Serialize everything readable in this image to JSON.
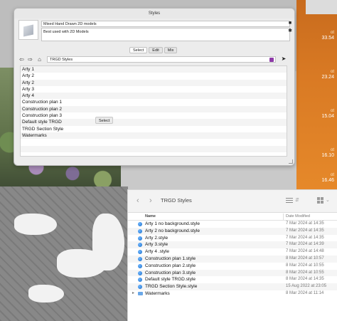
{
  "styles_panel": {
    "title": "Styles",
    "style_name": "Mixed Hand Drawn 2D models",
    "style_description": "Best used with 2D Models",
    "tabs": [
      {
        "label": "Select",
        "active": true
      },
      {
        "label": "Edit",
        "active": false
      },
      {
        "label": "Mix",
        "active": false
      }
    ],
    "collection": "TRGD Styles",
    "styles": [
      "Arty 1",
      "Arty 2",
      "Arty 2",
      "Arty 3",
      "Arty 4",
      "Construction plan 1",
      "Construction plan 2",
      "Construction plan 3",
      "Default style TRGD",
      "TRGD Section Style",
      "Watermarks"
    ],
    "tooltip": "Select"
  },
  "finder": {
    "title": "TRGD Styles",
    "columns": {
      "name": "Name",
      "date": "Date Modified"
    },
    "files": [
      {
        "name": "Arty 1 no background.style",
        "date": "7 Mar 2024 at 14:35",
        "kind": "file"
      },
      {
        "name": "Arty 2 no background.style",
        "date": "7 Mar 2024 at 14:35",
        "kind": "file"
      },
      {
        "name": "Arty 2.style",
        "date": "7 Mar 2024 at 14:35",
        "kind": "file"
      },
      {
        "name": "Arty 3.style",
        "date": "7 Mar 2024 at 14:39",
        "kind": "file"
      },
      {
        "name": "Arty 4 .style",
        "date": "7 Mar 2024 at 14:48",
        "kind": "file"
      },
      {
        "name": "Construction plan 1.style",
        "date": "8 Mar 2024 at 10:57",
        "kind": "file"
      },
      {
        "name": "Construction plan 2.style",
        "date": "8 Mar 2024 at 10:55",
        "kind": "file"
      },
      {
        "name": "Construction plan 3.style",
        "date": "8 Mar 2024 at 10:55",
        "kind": "file"
      },
      {
        "name": "Default style TRGD.style",
        "date": "8 Mar 2024 at 14:35",
        "kind": "file"
      },
      {
        "name": "TRGD Section Style.style",
        "date": "15 Aug 2022 at 23:05",
        "kind": "file"
      },
      {
        "name": "Watermarks",
        "date": "8 Mar 2024 at 11:14",
        "kind": "folder"
      }
    ]
  },
  "desktop_times": [
    {
      "label": "ot",
      "time": "33.54"
    },
    {
      "label": "ot",
      "time": "23.24"
    },
    {
      "label": "ot",
      "time": "15.04"
    },
    {
      "label": "ot",
      "time": "16.10"
    },
    {
      "label": "ot",
      "time": "16.46"
    }
  ],
  "colors": {
    "accent_purple": "#8e3aa8",
    "file_icon_blue": "#1d6fc9",
    "desktop_orange": "#d97a24"
  }
}
